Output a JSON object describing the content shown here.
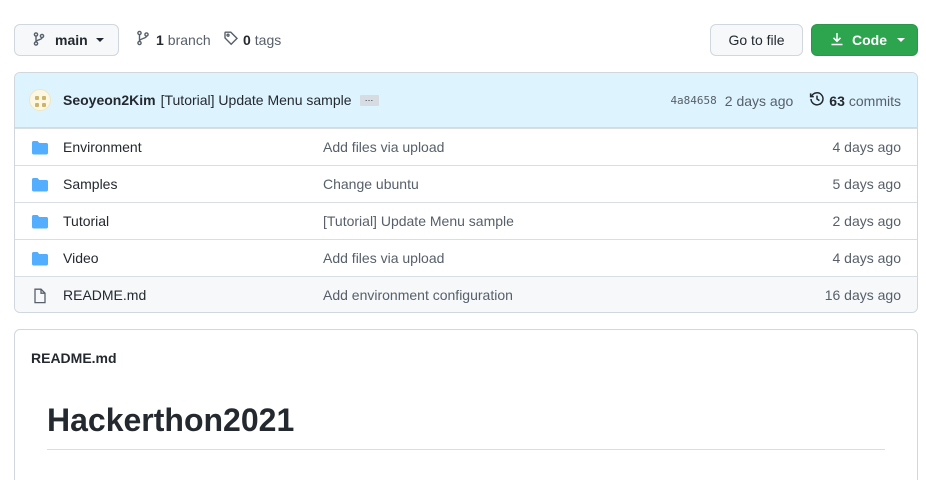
{
  "toolbar": {
    "branch_label": "main",
    "branches_count": "1",
    "branches_label": "branch",
    "tags_count": "0",
    "tags_label": "tags",
    "goto_file_label": "Go to file",
    "code_label": "Code"
  },
  "commit": {
    "author": "Seoyeon2Kim",
    "message": "[Tutorial] Update Menu sample",
    "ellipsis": "…",
    "sha": "4a84658",
    "time": "2 days ago",
    "commits_count": "63",
    "commits_label": "commits"
  },
  "files": [
    {
      "name": "Environment",
      "message": "Add files via upload",
      "age": "4 days ago",
      "type": "folder"
    },
    {
      "name": "Samples",
      "message": "Change ubuntu",
      "age": "5 days ago",
      "type": "folder"
    },
    {
      "name": "Tutorial",
      "message": "[Tutorial] Update Menu sample",
      "age": "2 days ago",
      "type": "folder"
    },
    {
      "name": "Video",
      "message": "Add files via upload",
      "age": "4 days ago",
      "type": "folder"
    },
    {
      "name": "README.md",
      "message": "Add environment configuration",
      "age": "16 days ago",
      "type": "file"
    }
  ],
  "readme": {
    "filename": "README.md",
    "heading": "Hackerthon2021"
  },
  "colors": {
    "accent_green": "#2da44e",
    "commit_bar": "#ddf4ff",
    "folder_blue": "#54aeff"
  },
  "icons": [
    "branch-icon",
    "git-branch-icon",
    "tag-icon",
    "download-icon",
    "history-icon",
    "folder-icon",
    "file-icon"
  ]
}
